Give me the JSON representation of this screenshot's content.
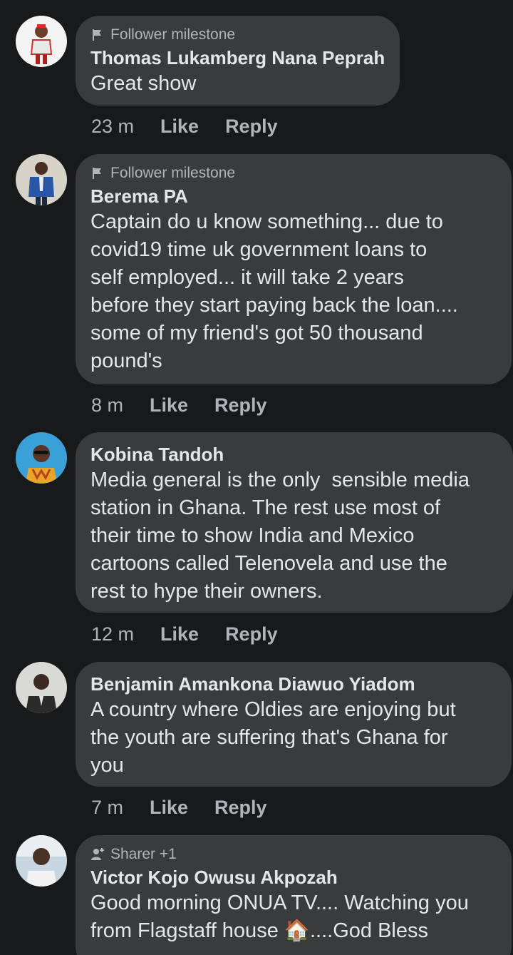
{
  "comments": [
    {
      "badge": "Follower milestone",
      "badge_icon": "flag-icon",
      "name": "Thomas Lukamberg Nana Peprah",
      "text": "Great show",
      "time": "23 m",
      "like": "Like",
      "reply": "Reply"
    },
    {
      "badge": "Follower milestone",
      "badge_icon": "flag-icon",
      "name": "Berema PA",
      "text": "Captain do u know something... due to\ncovid19 time uk government loans to\nself employed... it will take 2 years\nbefore they start paying back the loan....\nsome of my friend's got 50 thousand\npound's",
      "time": "8 m",
      "like": "Like",
      "reply": "Reply"
    },
    {
      "name": "Kobina Tandoh",
      "text": "Media general is the only  sensible media\nstation in Ghana. The rest use most of\ntheir time to show India and Mexico\ncartoons called Telenovela and use the\nrest to hype their owners.",
      "time": "12 m",
      "like": "Like",
      "reply": "Reply"
    },
    {
      "name": "Benjamin Amankona Diawuo Yiadom",
      "text": "A country where Oldies are enjoying but\nthe youth are suffering that's Ghana for\nyou",
      "time": "7 m",
      "like": "Like",
      "reply": "Reply"
    },
    {
      "badge": "Sharer +1",
      "badge_icon": "sharer-icon",
      "name": "Victor Kojo Owusu Akpozah",
      "text": "Good morning ONUA TV.... Watching you\nfrom Flagstaff house 🏠....God Bless"
    }
  ]
}
